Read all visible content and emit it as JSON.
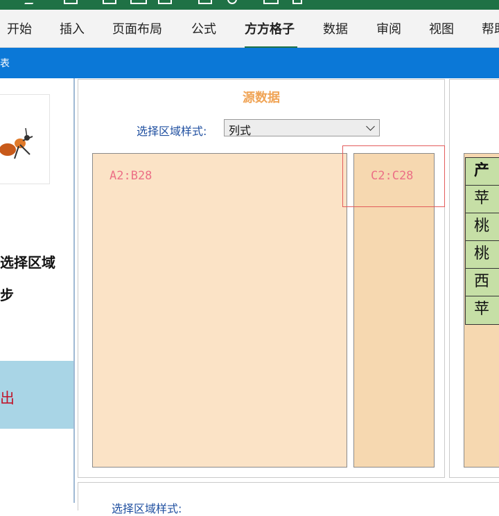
{
  "ribbon": {
    "tabs": [
      {
        "label": "开始"
      },
      {
        "label": "插入"
      },
      {
        "label": "页面布局"
      },
      {
        "label": "公式"
      },
      {
        "label": "方方格子",
        "active": true
      },
      {
        "label": "数据"
      },
      {
        "label": "审阅"
      },
      {
        "label": "视图"
      },
      {
        "label": "帮助"
      }
    ]
  },
  "dialog": {
    "title": "表"
  },
  "left_panel": {
    "step_line1": "选择区域",
    "step_line2": "步",
    "exit_label": "出"
  },
  "source": {
    "title": "源数据",
    "style_label": "选择区域样式:",
    "style_value": "列式",
    "range_a": "A2:B28",
    "range_c": "C2:C28"
  },
  "preview": {
    "header": "产",
    "rows": [
      "苹",
      "桃",
      "桃",
      "西",
      "苹"
    ]
  },
  "bottom": {
    "label": "选择区域样式:"
  },
  "colors": {
    "accent_green": "#1f7145",
    "titlebar_blue": "#0b78d7",
    "range_fill": "#fbe3c6",
    "highlight_red": "#e35a5a",
    "table_green": "#c6dfa6"
  }
}
